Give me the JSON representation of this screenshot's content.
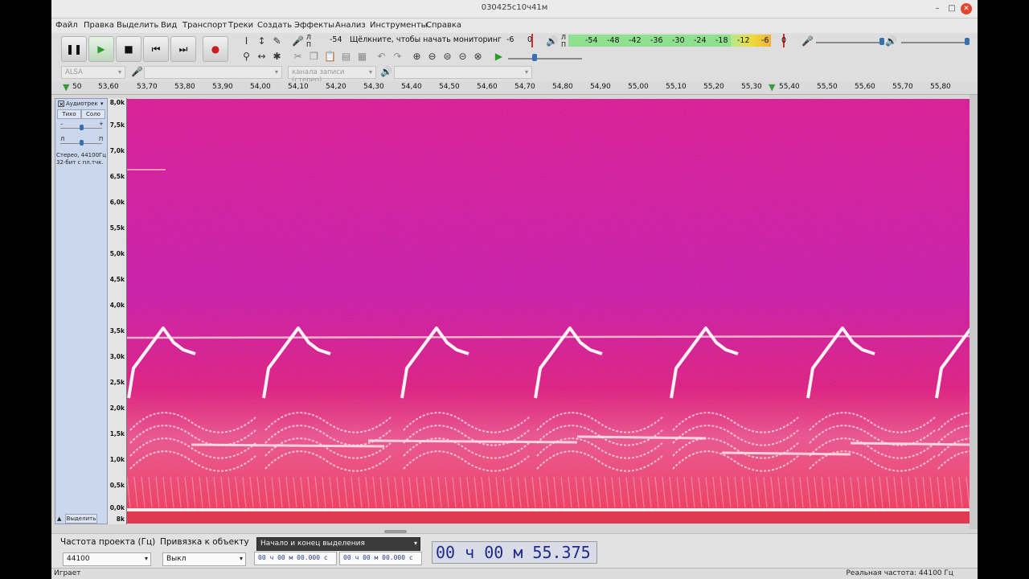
{
  "window": {
    "title": "030425с10ч41м"
  },
  "menu": [
    "Файл",
    "Правка",
    "Выделить",
    "Вид",
    "Транспорт",
    "Треки",
    "Создать",
    "Эффекты",
    "Анализ",
    "Инструменты",
    "Справка"
  ],
  "record_meter": {
    "l": "Л",
    "r": "П",
    "db_start": "-54",
    "prompt": "Щёлкните, чтобы начать мониторинг",
    "db_mid": "-6",
    "db_end": "0"
  },
  "play_meter": {
    "l": "Л",
    "r": "П",
    "scale": [
      "-54",
      "-48",
      "-42",
      "-36",
      "-30",
      "-24",
      "-18",
      "-12",
      "-6",
      "0"
    ]
  },
  "device": {
    "host": "ALSA",
    "channels": "канала записи (стерео)"
  },
  "ruler_ticks": [
    "50",
    "53,60",
    "53,70",
    "53,80",
    "53,90",
    "54,00",
    "54,10",
    "54,20",
    "54,30",
    "54,40",
    "54,50",
    "54,60",
    "54,70",
    "54,80",
    "54,90",
    "55,00",
    "55,10",
    "55,20",
    "55,30",
    "55,40",
    "55,50",
    "55,60",
    "55,70",
    "55,80"
  ],
  "track": {
    "name": "Аудиотрек",
    "mute": "Тихо",
    "solo": "Соло",
    "minus": "–",
    "plus": "+",
    "pan_l": "Л",
    "pan_r": "П",
    "info1": "Стерео, 44100Гц",
    "info2": "32-бит с пл.тчк.",
    "select": "Выделить"
  },
  "freq_labels": [
    "8,0k",
    "7,5k",
    "7,0k",
    "6,5k",
    "6,0k",
    "5,5k",
    "5,0k",
    "4,5k",
    "4,0k",
    "3,5k",
    "3,0k",
    "2,5k",
    "2,0k",
    "1,5k",
    "1,0k",
    "0,5k",
    "0,0k",
    "8k"
  ],
  "bottom": {
    "rate_label": "Частота проекта (Гц)",
    "rate_value": "44100",
    "snap_label": "Привязка к объекту",
    "snap_value": "Выкл",
    "sel_mode": "Начало и конец выделения",
    "sel_start": "00 ч 00 м 00.000 с",
    "sel_end": "00 ч 00 м 00.000 с",
    "time": "00 ч 00 м 55.375 с"
  },
  "status": {
    "left": "Играет",
    "right": "Реальная частота: 44100 Гц"
  },
  "colors": {
    "spectrogram_bg": "#d62b66",
    "spectrogram_hot": "#f4445a",
    "spectrogram_cool": "#7b2be0",
    "trace": "#fff2f2"
  }
}
